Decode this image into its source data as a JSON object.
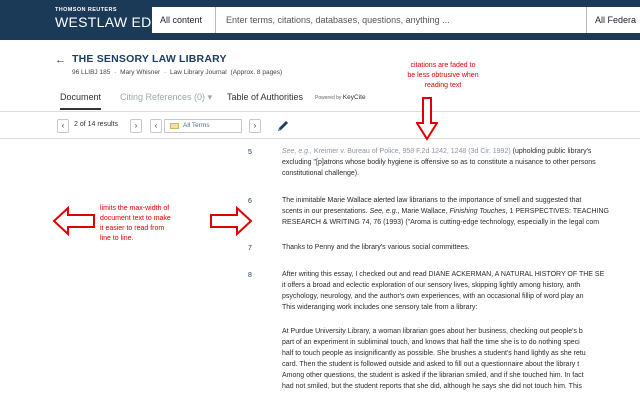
{
  "brand": {
    "top": "THOMSON REUTERS",
    "name": "WESTLAW EDGE"
  },
  "search": {
    "scope": "All content",
    "placeholder": "Enter terms, citations, databases, questions, anything ...",
    "jurisdiction": "All Federa"
  },
  "document": {
    "title": "THE SENSORY LAW LIBRARY",
    "meta": [
      "96 LLIBJ 185",
      "·",
      "Mary Whisner",
      "·",
      "Law Library Journal",
      "(Approx. 8 pages)"
    ]
  },
  "tabs": {
    "document": "Document",
    "citing": "Citing References (0)",
    "authorities": "Table of Authorities",
    "powered_by": "Powered by",
    "keycite": "KeyCite"
  },
  "toolbar": {
    "results": "2 of 14 results",
    "terms": "All Terms"
  },
  "annotations": {
    "citations": [
      "citations are faded to",
      "be less obtrusive when",
      "reading text"
    ],
    "maxwidth": [
      "limits the max-width of",
      "document text to make",
      "it easier to read from",
      "line to line."
    ]
  },
  "footnotes": [
    {
      "num": "5",
      "lines": [
        [
          {
            "t": "See, e.g.,",
            "s": "cite ital"
          },
          {
            "t": " Kreimer v. Bureau of Police, 958 F.2d 1242, 1248 (3d Cir. 1992)",
            "s": "cite"
          },
          {
            "t": " (upholding public library's",
            "s": ""
          }
        ],
        [
          {
            "t": "excluding \"[p]atrons whose bodily hygiene is offensive so as to constitute a nuisance to other persons",
            "s": ""
          }
        ],
        [
          {
            "t": "constitutional challenge).",
            "s": ""
          }
        ]
      ]
    },
    {
      "num": "6",
      "lines": [
        [
          {
            "t": "The inimitable Marie Wallace alerted law librarians to the importance of smell and suggested that",
            "s": ""
          }
        ],
        [
          {
            "t": "scents in our presentations. ",
            "s": ""
          },
          {
            "t": "See, e.g.",
            "s": "ital"
          },
          {
            "t": ", Marie Wallace, ",
            "s": ""
          },
          {
            "t": "Finishing Touches",
            "s": "ital"
          },
          {
            "t": ", 1 PERSPECTIVES: TEACHING",
            "s": ""
          }
        ],
        [
          {
            "t": "RESEARCH & WRITING 74, 76 (1993) (\"Aroma is cutting-edge technology, especially in the legal com",
            "s": ""
          }
        ]
      ]
    },
    {
      "num": "7",
      "lines": [
        [
          {
            "t": "Thanks to Penny and the library's various social committees.",
            "s": ""
          }
        ]
      ]
    },
    {
      "num": "8",
      "lines": [
        [
          {
            "t": "After writing this essay, I checked out and read DIANE ACKERMAN, A NATURAL HISTORY OF THE SE",
            "s": ""
          }
        ],
        [
          {
            "t": "it offers a broad and eclectic exploration of our sensory lives, skipping lightly among history, anth",
            "s": ""
          }
        ],
        [
          {
            "t": "psychology, neurology, and the author's own experiences, with an occasional fillip of word play an",
            "s": ""
          }
        ],
        [
          {
            "t": "This wideranging work includes one sensory tale from a library:",
            "s": ""
          }
        ]
      ]
    },
    {
      "num": "",
      "lines": [
        [
          {
            "t": "At Purdue University Library, a woman librarian goes about her business, checking out people's b",
            "s": ""
          }
        ],
        [
          {
            "t": "part of an experiment in subliminal touch, and knows that half the time she is to do nothing speci",
            "s": ""
          }
        ],
        [
          {
            "t": "half to touch people as insignificantly as possible. She brushes a student's hand lightly as she retu",
            "s": ""
          }
        ],
        [
          {
            "t": "card. Then the student is followed outside and asked to fill out a questionnaire about the library t",
            "s": ""
          }
        ],
        [
          {
            "t": "Among other questions, the student is asked if the librarian smiled, and if she touched him. In fact",
            "s": ""
          }
        ],
        [
          {
            "t": "had not smiled, but the student reports that she did, although he says she did not touch him. This",
            "s": ""
          }
        ]
      ]
    }
  ]
}
